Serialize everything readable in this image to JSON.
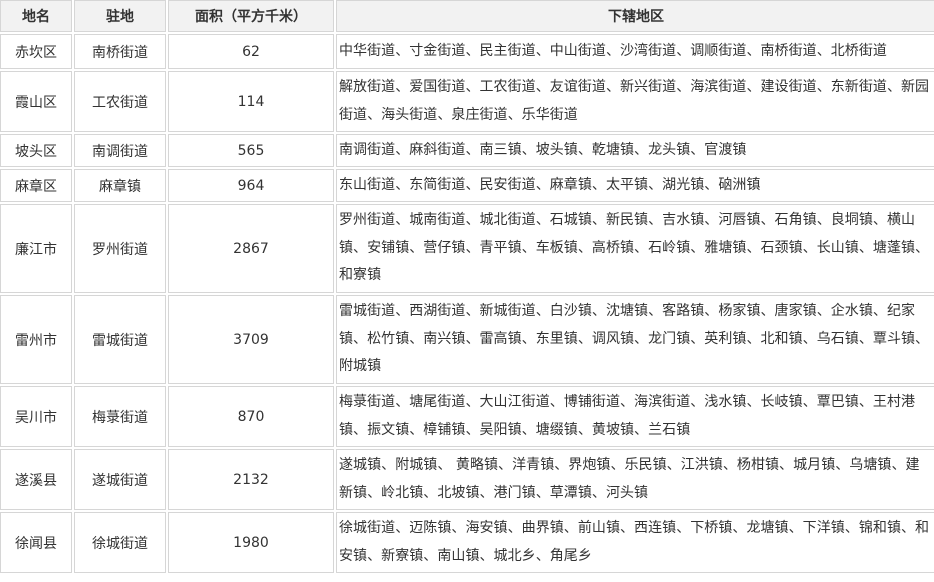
{
  "table": {
    "headers": {
      "name": "地名",
      "seat": "驻地",
      "area": "面积（平方千米）",
      "subdivisions": "下辖地区"
    },
    "rows": [
      {
        "name": "赤坎区",
        "seat": "南桥街道",
        "area": "62",
        "subdivisions": "中华街道、寸金街道、民主街道、中山街道、沙湾街道、调顺街道、南桥街道、北桥街道"
      },
      {
        "name": "霞山区",
        "seat": "工农街道",
        "area": "114",
        "subdivisions": "解放街道、爱国街道、工农街道、友谊街道、新兴街道、海滨街道、建设街道、东新街道、新园街道、海头街道、泉庄街道、乐华街道"
      },
      {
        "name": "坡头区",
        "seat": "南调街道",
        "area": "565",
        "subdivisions": "南调街道、麻斜街道、南三镇、坡头镇、乾塘镇、龙头镇、官渡镇"
      },
      {
        "name": "麻章区",
        "seat": "麻章镇",
        "area": "964",
        "subdivisions": "东山街道、东简街道、民安街道、麻章镇、太平镇、湖光镇、硇洲镇"
      },
      {
        "name": "廉江市",
        "seat": "罗州街道",
        "area": "2867",
        "subdivisions": "罗州街道、城南街道、城北街道、石城镇、新民镇、吉水镇、河唇镇、石角镇、良垌镇、横山镇、安铺镇、营仔镇、青平镇、车板镇、高桥镇、石岭镇、雅塘镇、石颈镇、长山镇、塘蓬镇、和寮镇"
      },
      {
        "name": "雷州市",
        "seat": "雷城街道",
        "area": "3709",
        "subdivisions": "雷城街道、西湖街道、新城街道、白沙镇、沈塘镇、客路镇、杨家镇、唐家镇、企水镇、纪家镇、松竹镇、南兴镇、雷高镇、东里镇、调风镇、龙门镇、英利镇、北和镇、乌石镇、覃斗镇、附城镇"
      },
      {
        "name": "吴川市",
        "seat": "梅菉街道",
        "area": "870",
        "subdivisions": "梅菉街道、塘尾街道、大山江街道、博铺街道、海滨街道、浅水镇、长岐镇、覃巴镇、王村港镇、振文镇、樟铺镇、吴阳镇、塘缀镇、黄坡镇、兰石镇"
      },
      {
        "name": "遂溪县",
        "seat": "遂城街道",
        "area": "2132",
        "subdivisions": "遂城镇、附城镇、 黄略镇、洋青镇、界炮镇、乐民镇、江洪镇、杨柑镇、城月镇、乌塘镇、建新镇、岭北镇、北坡镇、港门镇、草潭镇、河头镇"
      },
      {
        "name": "徐闻县",
        "seat": "徐城街道",
        "area": "1980",
        "subdivisions": "徐城街道、迈陈镇、海安镇、曲界镇、前山镇、西连镇、下桥镇、龙塘镇、下洋镇、锦和镇、和安镇、新寮镇、南山镇、城北乡、角尾乡"
      }
    ]
  }
}
